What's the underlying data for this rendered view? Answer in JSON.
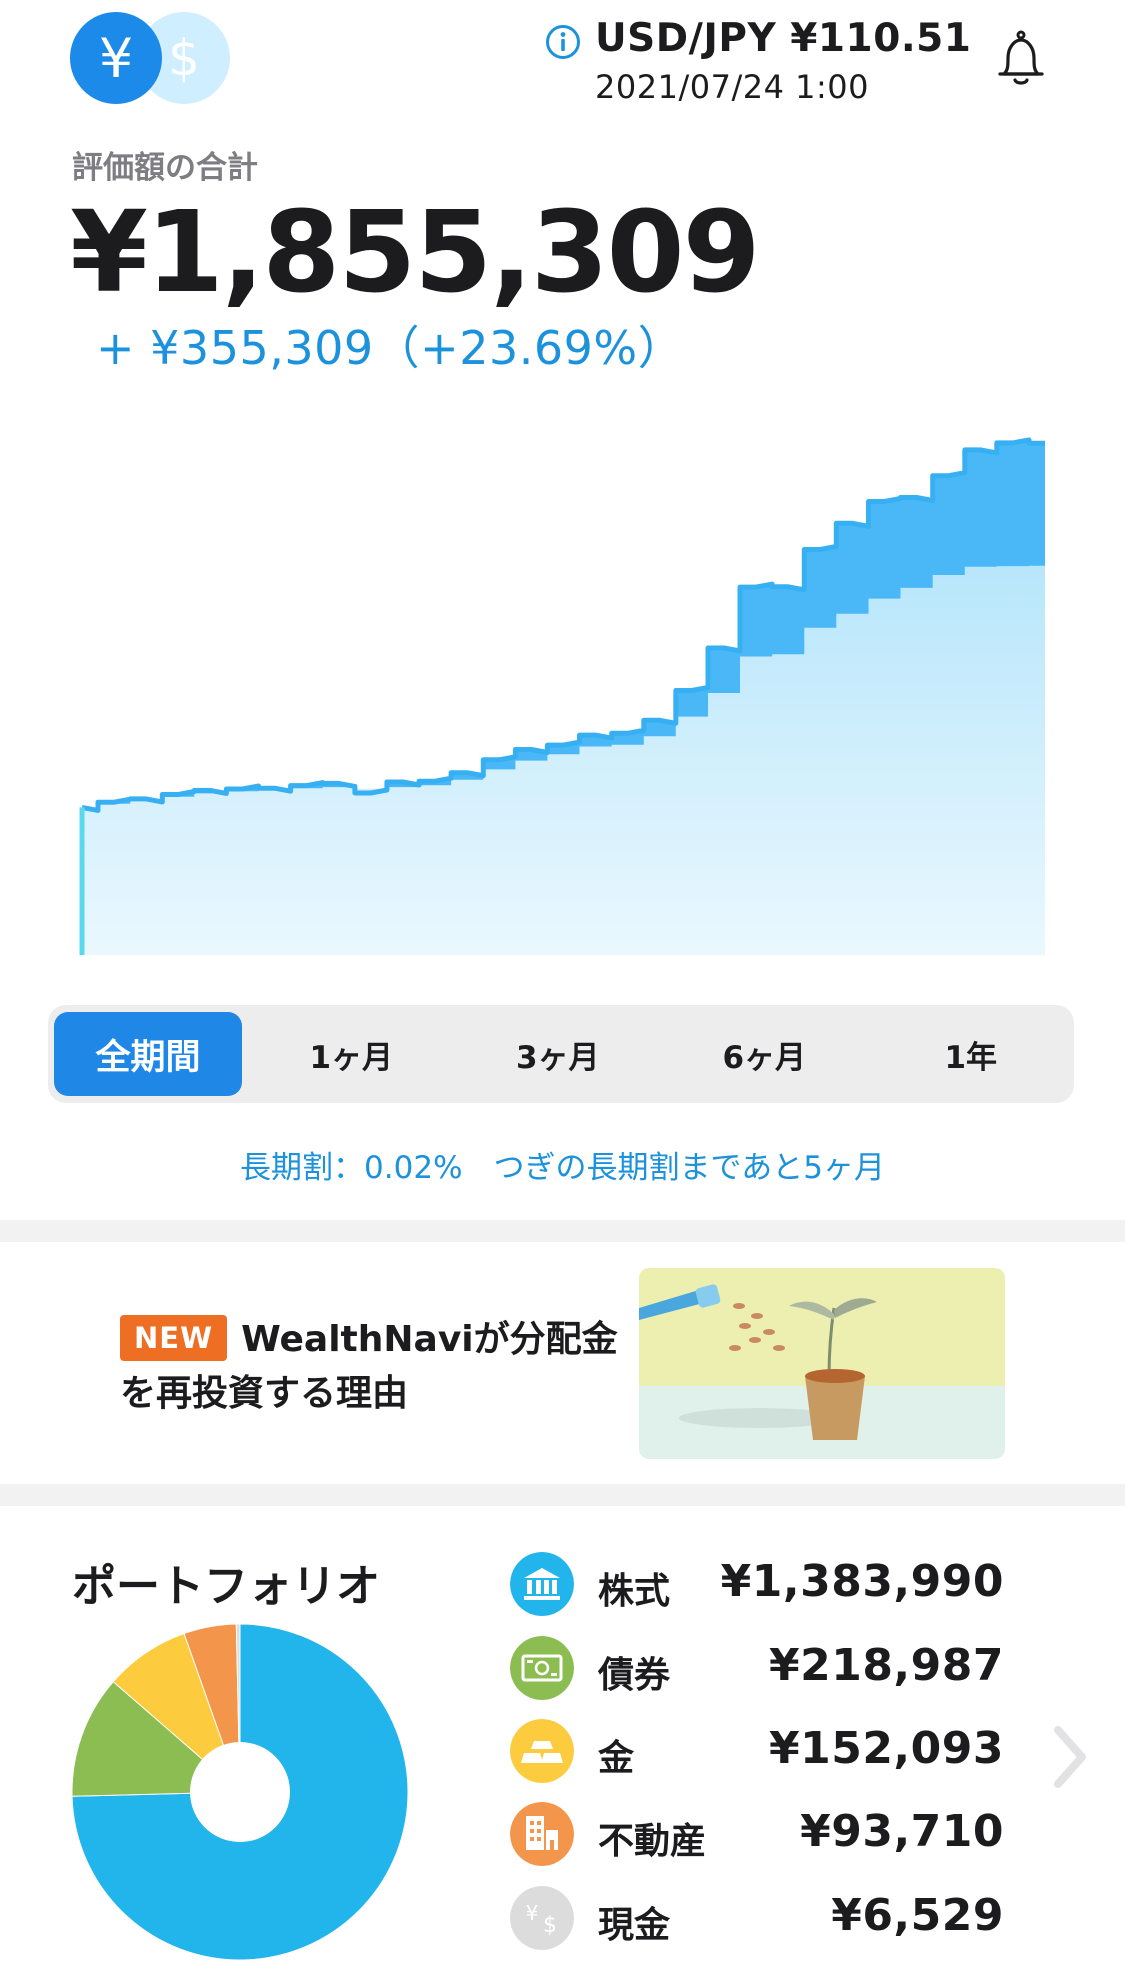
{
  "header": {
    "currency_primary": "¥",
    "currency_secondary": "$",
    "rate_label": "USD/JPY  ¥110.51",
    "rate_timestamp": "2021/07/24 1:00",
    "info_icon": "info-icon",
    "bell_icon": "bell-icon"
  },
  "summary": {
    "total_label": "評価額の合計",
    "total_value": "¥1,855,309",
    "change": "+ ¥355,309（+23.69%）"
  },
  "chart_data": {
    "type": "area",
    "series": [
      {
        "values": [
          100.0,
          101.4,
          102.3,
          103.5,
          104.6,
          105.0,
          105.2,
          105.9,
          106.5,
          103.9,
          106.9,
          107.1,
          109.4,
          112.9,
          115.7,
          116.9,
          119.6,
          120.1,
          123.6,
          131.7,
          143.2,
          159.7,
          159.8,
          169.9,
          177.0,
          182.9,
          184.0,
          189.9,
          196.9,
          198.8,
          198.7
        ]
      },
      {
        "values": [
          100.0,
          101.0,
          101.9,
          102.9,
          103.8,
          104.4,
          104.9,
          105.2,
          105.5,
          105.1,
          105.5,
          106.0,
          107.5,
          110.3,
          112.7,
          114.4,
          116.5,
          117.0,
          119.3,
          124.6,
          131.0,
          140.9,
          141.5,
          148.7,
          152.5,
          156.6,
          159.5,
          163.0,
          165.2,
          165.4,
          165.5
        ]
      }
    ],
    "grid": false,
    "colors": [
      "#4ab8f7",
      "#d4f0fd"
    ]
  },
  "period_tabs": [
    "全期間",
    "1ヶ月",
    "3ヶ月",
    "6ヶ月",
    "1年"
  ],
  "fee_notice": "長期割：0.02%　つぎの長期割まであと5ヶ月",
  "banner": {
    "badge": "NEW",
    "text": "WealthNaviが分配金を再投資する理由"
  },
  "portfolio": {
    "title": "ポートフォリオ",
    "assets": [
      {
        "name": "株式",
        "value": "¥1,383,990",
        "icon": "bank-icon",
        "color": "#22b5ec",
        "amount": 1383990
      },
      {
        "name": "債券",
        "value": "¥218,987",
        "icon": "bill-icon",
        "color": "#8cbd52",
        "amount": 218987
      },
      {
        "name": "金",
        "value": "¥152,093",
        "icon": "gold-bars-icon",
        "color": "#fccb3e",
        "amount": 152093
      },
      {
        "name": "不動産",
        "value": "¥93,710",
        "icon": "building-icon",
        "color": "#f4954c",
        "amount": 93710
      },
      {
        "name": "現金",
        "value": "¥6,529",
        "icon": "cash-icon",
        "color": "#dcdcdc",
        "amount": 6529
      }
    ]
  }
}
